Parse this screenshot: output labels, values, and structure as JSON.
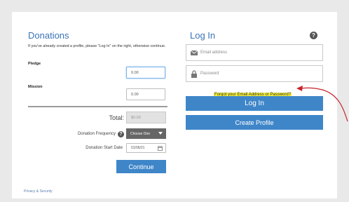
{
  "donations": {
    "title": "Donations",
    "intro": "If you've already created a profile, please \"Log In\" on the right, otherwise continue.",
    "pledge_label": "Pledge",
    "pledge_value": "0.00",
    "mission_label": "Mission",
    "mission_value": "0.00",
    "total_label": "Total:",
    "total_value": "$0.00",
    "frequency_label": "Donation Frequency",
    "frequency_value": "Choose One",
    "start_date_label": "Donation Start Date",
    "start_date_value": "01/06/21",
    "continue_label": "Continue"
  },
  "login": {
    "title": "Log In",
    "email_placeholder": "Email address",
    "password_placeholder": "Password",
    "forgot_label": "Forgot your Email Address or Password?",
    "login_button": "Log In",
    "create_profile_button": "Create Profile"
  },
  "footer": {
    "privacy_link": "Privacy & Security"
  },
  "colors": {
    "accent": "#3f86c9",
    "title_blue": "#3a73b5",
    "highlight": "#f4f03a",
    "annotation_arrow": "#c8232b"
  }
}
